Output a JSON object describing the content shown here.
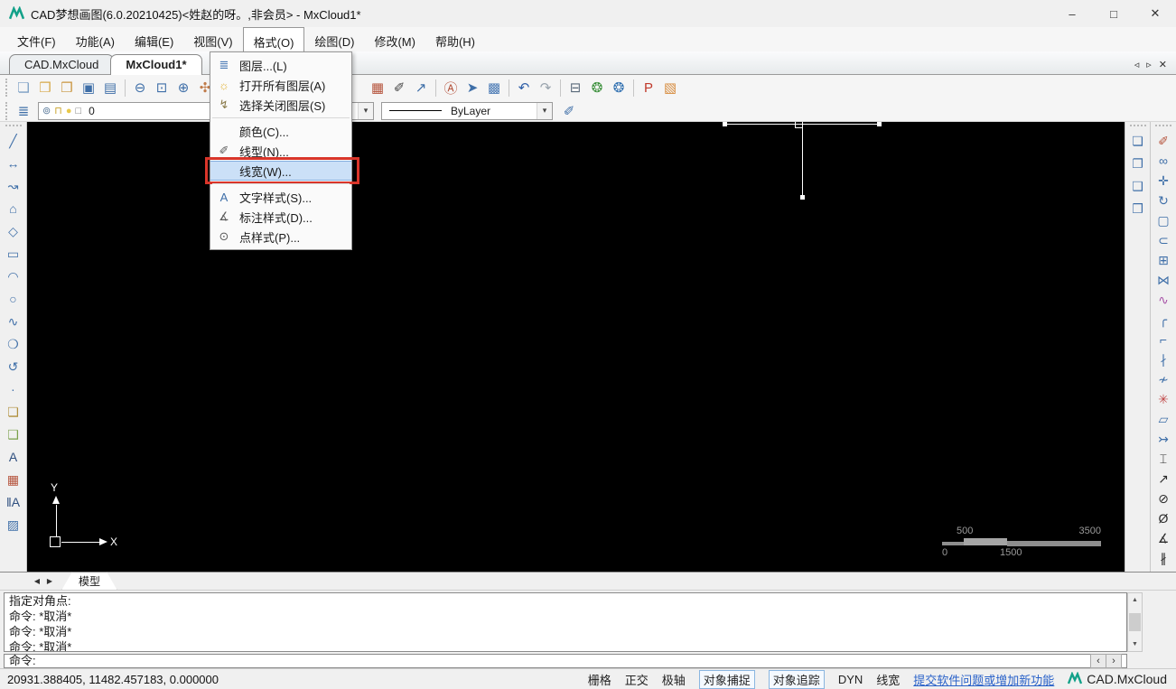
{
  "window": {
    "title": "CAD梦想画图(6.0.20210425)<姓赵的呀。,非会员> - MxCloud1*",
    "controls": [
      {
        "name": "minimize-button",
        "glyph": "–"
      },
      {
        "name": "maximize-button",
        "glyph": "□"
      },
      {
        "name": "close-button",
        "glyph": "✕"
      }
    ]
  },
  "menubar": {
    "items": [
      {
        "name": "menu-file",
        "label": "文件(F)"
      },
      {
        "name": "menu-function",
        "label": "功能(A)"
      },
      {
        "name": "menu-edit",
        "label": "编辑(E)"
      },
      {
        "name": "menu-view",
        "label": "视图(V)"
      },
      {
        "name": "menu-format",
        "label": "格式(O)",
        "open": true
      },
      {
        "name": "menu-draw",
        "label": "绘图(D)"
      },
      {
        "name": "menu-modify",
        "label": "修改(M)"
      },
      {
        "name": "menu-help",
        "label": "帮助(H)"
      }
    ]
  },
  "tabbar": {
    "tabs": [
      {
        "name": "tab-cad-mxcloud",
        "label": "CAD.MxCloud"
      },
      {
        "name": "tab-mxcloud1",
        "label": "MxCloud1*",
        "active": true
      }
    ],
    "controls": [
      {
        "name": "tab-scroll-left-button",
        "glyph": "◃"
      },
      {
        "name": "tab-scroll-right-button",
        "glyph": "▹"
      },
      {
        "name": "tab-close-button",
        "glyph": "✕"
      }
    ]
  },
  "format_menu": {
    "items": [
      {
        "name": "menu-item-layers",
        "label": "图层...(L)",
        "glyph": "≣",
        "color": "#4a7ab5"
      },
      {
        "name": "menu-item-open-all-layers",
        "label": "打开所有图层(A)",
        "glyph": "☼",
        "color": "#e2b43c"
      },
      {
        "name": "menu-item-select-off-layers",
        "label": "选择关闭图层(S)",
        "glyph": "↯",
        "color": "#8a7a4a"
      },
      {
        "type": "separator"
      },
      {
        "name": "menu-item-color",
        "label": "颜色(C)...",
        "glyph": ""
      },
      {
        "name": "menu-item-linetype",
        "label": "线型(N)...",
        "glyph": "✐",
        "color": "#5a5a5a"
      },
      {
        "name": "menu-item-lineweight",
        "label": "线宽(W)...",
        "glyph": "",
        "highlighted": true
      },
      {
        "type": "separator"
      },
      {
        "name": "menu-item-text-style",
        "label": "文字样式(S)...",
        "glyph": "A",
        "color": "#3f6fa8"
      },
      {
        "name": "menu-item-dim-style",
        "label": "标注样式(D)...",
        "glyph": "∡",
        "color": "#5a5a5a"
      },
      {
        "name": "menu-item-point-style",
        "label": "点样式(P)...",
        "glyph": "⊙",
        "color": "#5a5a5a"
      }
    ]
  },
  "toolbar_main": {
    "items": [
      {
        "name": "new-button",
        "glyph": "❏",
        "color": "#7d9fc4"
      },
      {
        "name": "open-button",
        "glyph": "❒",
        "color": "#d7a94a"
      },
      {
        "name": "open-cloud-button",
        "glyph": "❒",
        "color": "#c9953f"
      },
      {
        "name": "save-button",
        "glyph": "▣",
        "color": "#3f6fa8"
      },
      {
        "name": "save-as-button",
        "glyph": "▤",
        "color": "#3f6fa8"
      },
      {
        "type": "separator"
      },
      {
        "name": "zoom-dynamic-button",
        "glyph": "⊖",
        "color": "#3f6fa8"
      },
      {
        "name": "zoom-window-button",
        "glyph": "⊡",
        "color": "#3f6fa8"
      },
      {
        "name": "zoom-extents-button",
        "glyph": "⊕",
        "color": "#3f6fa8"
      },
      {
        "name": "pan-button",
        "glyph": "✣",
        "color": "#c07b4a"
      },
      {
        "name": "measure-button",
        "glyph": "∟",
        "color": "#3f6fa8"
      },
      {
        "type": "spacer"
      },
      {
        "name": "color-palette-button",
        "glyph": "▦",
        "color": "#b5533c"
      },
      {
        "name": "linetype-button",
        "glyph": "✐",
        "color": "#444444"
      },
      {
        "name": "export-button",
        "glyph": "↗",
        "color": "#3f6fa8"
      },
      {
        "type": "separator"
      },
      {
        "name": "find-replace-button",
        "glyph": "Ⓐ",
        "color": "#b5533c"
      },
      {
        "name": "select-button",
        "glyph": "➤",
        "color": "#3f6fa8"
      },
      {
        "name": "paste-image-button",
        "glyph": "▩",
        "color": "#4a7ab5"
      },
      {
        "type": "separator"
      },
      {
        "name": "undo-button",
        "glyph": "↶",
        "color": "#2f5fa8"
      },
      {
        "name": "redo-button",
        "glyph": "↷",
        "color": "#9aa4ae"
      },
      {
        "type": "separator"
      },
      {
        "name": "print-button",
        "glyph": "⊟",
        "color": "#5a6a7a"
      },
      {
        "name": "mxcloud-home-button",
        "glyph": "❂",
        "color": "#3a8f3a"
      },
      {
        "name": "mxcloud-sync-button",
        "glyph": "❂",
        "color": "#2f6fb0"
      },
      {
        "type": "separator"
      },
      {
        "name": "pdf-export-button",
        "glyph": "P",
        "color": "#c0392b"
      },
      {
        "name": "image-export-button",
        "glyph": "▧",
        "color": "#d78a3a"
      }
    ]
  },
  "toolbar_props": {
    "layers_button_glyph": "≣",
    "layer_combo": {
      "icons": [
        {
          "name": "layer-visible-icon",
          "glyph": "⊚",
          "color": "#5a7a9a"
        },
        {
          "name": "layer-lock-icon",
          "glyph": "⊓",
          "color": "#c9a227"
        },
        {
          "name": "layer-color-icon",
          "glyph": "●",
          "color": "#e8c84a"
        },
        {
          "name": "layer-plot-icon",
          "glyph": "□",
          "color": "#777777"
        }
      ],
      "value": "0"
    },
    "linetype_combo": {
      "value": "ByLayer"
    },
    "lineweight_button_glyph": "✐"
  },
  "left_toolbar": {
    "items": [
      {
        "name": "line-button",
        "glyph": "╱"
      },
      {
        "name": "construction-line-button",
        "glyph": "↔"
      },
      {
        "name": "polyline-button",
        "glyph": "↝"
      },
      {
        "name": "polygon-button",
        "glyph": "⌂"
      },
      {
        "name": "inscribed-polygon-button",
        "glyph": "◇"
      },
      {
        "name": "rectangle-button",
        "glyph": "▭"
      },
      {
        "name": "arc-button",
        "glyph": "◠"
      },
      {
        "name": "circle-button",
        "glyph": "○"
      },
      {
        "name": "spline-button",
        "glyph": "∿"
      },
      {
        "name": "ellipse-button",
        "glyph": "❍"
      },
      {
        "name": "revision-cloud-button",
        "glyph": "↺"
      },
      {
        "name": "point-button",
        "glyph": "∙"
      },
      {
        "name": "block-create-button",
        "glyph": "❏",
        "color": "#b08f3c"
      },
      {
        "name": "block-insert-button",
        "glyph": "❑",
        "color": "#7aa04a"
      },
      {
        "name": "text-button",
        "glyph": "A",
        "color": "#2f4f7f"
      },
      {
        "name": "table-button",
        "glyph": "▦",
        "color": "#b5533c"
      },
      {
        "name": "mtext-button",
        "glyph": "‖A",
        "color": "#2f4f7f"
      },
      {
        "name": "hatch-button",
        "glyph": "▨"
      }
    ]
  },
  "right_inner_toolbar": {
    "items": [
      {
        "name": "draw-order-front-button",
        "glyph": "❏"
      },
      {
        "name": "draw-order-back-button",
        "glyph": "❐"
      },
      {
        "name": "draw-order-above-button",
        "glyph": "❑"
      },
      {
        "name": "draw-order-below-button",
        "glyph": "❒"
      }
    ]
  },
  "right_outer_toolbar": {
    "items": [
      {
        "name": "erase-button",
        "glyph": "✐",
        "color": "#b5533c"
      },
      {
        "name": "copy-button",
        "glyph": "∞",
        "color": "#3f6fa8"
      },
      {
        "name": "move-button",
        "glyph": "✛",
        "color": "#3f6fa8"
      },
      {
        "name": "rotate-button",
        "glyph": "↻",
        "color": "#3f6fa8"
      },
      {
        "name": "select-window-button",
        "glyph": "▢",
        "color": "#3f6fa8"
      },
      {
        "name": "offset-button",
        "glyph": "⊂",
        "color": "#3f6fa8"
      },
      {
        "name": "array-button",
        "glyph": "⊞",
        "color": "#3f6fa8"
      },
      {
        "name": "mirror-button",
        "glyph": "⋈",
        "color": "#3f6fa8"
      },
      {
        "name": "polyline-edit-button",
        "glyph": "∿",
        "color": "#a855a8"
      },
      {
        "name": "fillet-button",
        "glyph": "╭",
        "color": "#3f6fa8"
      },
      {
        "name": "chamfer-button",
        "glyph": "⌐",
        "color": "#3f6fa8"
      },
      {
        "name": "break-button",
        "glyph": "∤",
        "color": "#3f6fa8"
      },
      {
        "name": "trim-button",
        "glyph": "≁",
        "color": "#3f6fa8"
      },
      {
        "name": "explode-button",
        "glyph": "✳",
        "color": "#c04848"
      },
      {
        "name": "scale-button",
        "glyph": "▱",
        "color": "#3f6fa8"
      },
      {
        "name": "join-button",
        "glyph": "↣",
        "color": "#3f6fa8"
      },
      {
        "name": "dim-linear-button",
        "glyph": "⌶",
        "color": "#2b2b2b"
      },
      {
        "name": "dim-aligned-button",
        "glyph": "↗",
        "color": "#2b2b2b"
      },
      {
        "name": "dim-radius-button",
        "glyph": "⊘",
        "color": "#2b2b2b"
      },
      {
        "name": "dim-diameter-button",
        "glyph": "Ø",
        "color": "#2b2b2b"
      },
      {
        "name": "dim-angular-button",
        "glyph": "∡",
        "color": "#2b2b2b"
      },
      {
        "name": "dim-continue-button",
        "glyph": "∦",
        "color": "#2b2b2b"
      }
    ]
  },
  "canvas": {
    "ucs": {
      "x_label": "X",
      "y_label": "Y"
    },
    "scalebar": {
      "top_left": "500",
      "top_right": "3500",
      "bottom_left": "0",
      "bottom_mid": "1500"
    }
  },
  "model_bar": {
    "prev_glyph": "◀",
    "next_glyph": "▶",
    "tab_label": "模型"
  },
  "command": {
    "history": [
      "指定对角点:",
      "命令:  *取消*",
      "命令:  *取消*",
      "命令:  *取消*"
    ],
    "prompt": "命令:",
    "nav": [
      {
        "name": "cmd-scroll-left-button",
        "glyph": "‹"
      },
      {
        "name": "cmd-scroll-right-button",
        "glyph": "›"
      }
    ]
  },
  "statusbar": {
    "coords": "20931.388405, 11482.457183, 0.000000",
    "toggles": [
      {
        "name": "toggle-grid",
        "label": "栅格"
      },
      {
        "name": "toggle-ortho",
        "label": "正交"
      },
      {
        "name": "toggle-polar",
        "label": "极轴"
      },
      {
        "name": "toggle-osnap",
        "label": "对象捕捉",
        "boxed": true
      },
      {
        "name": "toggle-otrack",
        "label": "对象追踪",
        "boxed": true
      },
      {
        "name": "toggle-dyn",
        "label": "DYN"
      },
      {
        "name": "toggle-lineweight",
        "label": "线宽"
      }
    ],
    "link": "提交软件问题或增加新功能",
    "brand": "CAD.MxCloud"
  },
  "colors": {
    "canvas_bg": "#000000",
    "menu_highlight": "#cbe0f7",
    "annotation_red": "#d9352a",
    "link_blue": "#2a62c9",
    "brand_green": "#13a189",
    "icon_blue": "#3f6fa8"
  }
}
